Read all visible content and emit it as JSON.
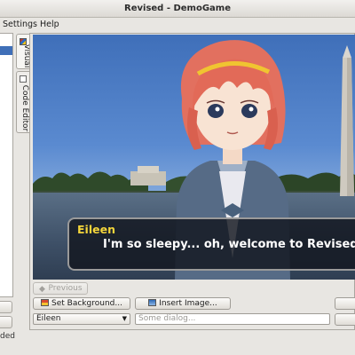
{
  "window": {
    "title": "Revised - DemoGame"
  },
  "menubar": {
    "items": [
      {
        "label": "Settings"
      },
      {
        "label": "Help"
      }
    ]
  },
  "tabs": [
    {
      "label": "Visual",
      "active": true
    },
    {
      "label": "Code Editor",
      "active": false
    }
  ],
  "left_panel": {
    "status_text": "ded"
  },
  "game": {
    "speaker": "Eileen",
    "dialogue": "I'm so sleepy... oh, welcome to Revised",
    "speaker_color": "#f4d53b"
  },
  "controls": {
    "previous_label": "Previous",
    "set_background_label": "Set Background...",
    "insert_image_label": "Insert Image...",
    "character_select_value": "Eileen",
    "dialog_placeholder": "Some dialog..."
  },
  "colors": {
    "accent_selection": "#3f6fb8",
    "dialogue_text": "#ffffff"
  }
}
